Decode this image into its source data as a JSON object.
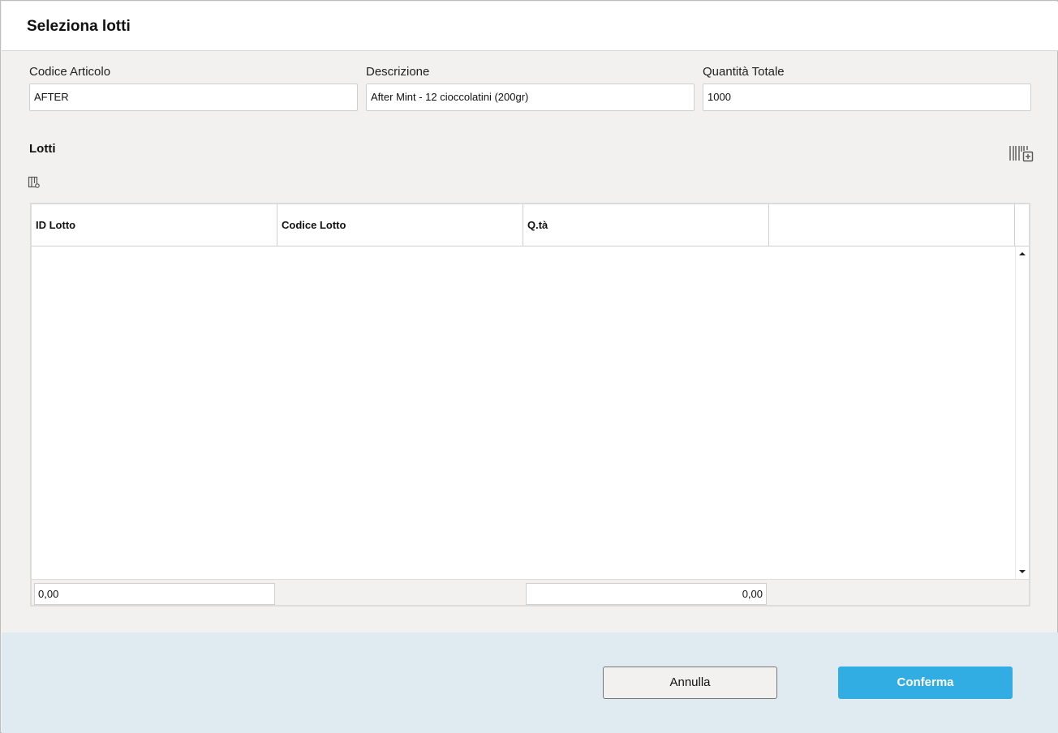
{
  "dialog": {
    "title": "Seleziona lotti"
  },
  "fields": {
    "codice_articolo": {
      "label": "Codice Articolo",
      "value": "AFTER"
    },
    "descrizione": {
      "label": "Descrizione",
      "value": "After Mint - 12 cioccolatini (200gr)"
    },
    "quantita_totale": {
      "label": "Quantità Totale",
      "value": "1000"
    }
  },
  "lotti": {
    "section_title": "Lotti",
    "columns": [
      "ID Lotto",
      "Codice Lotto",
      "Q.tà",
      ""
    ],
    "rows": [],
    "totals": {
      "id_lotto": "0,00",
      "quantita": "0,00"
    }
  },
  "buttons": {
    "cancel_label": "Annulla",
    "confirm_label": "Conferma"
  },
  "icons": {
    "barcode_add": "barcode-add-icon",
    "column_settings": "column-settings-icon"
  },
  "colors": {
    "accent": "#32ade3",
    "footer_background": "#dfebf0",
    "body_background": "#f2f1f0"
  }
}
